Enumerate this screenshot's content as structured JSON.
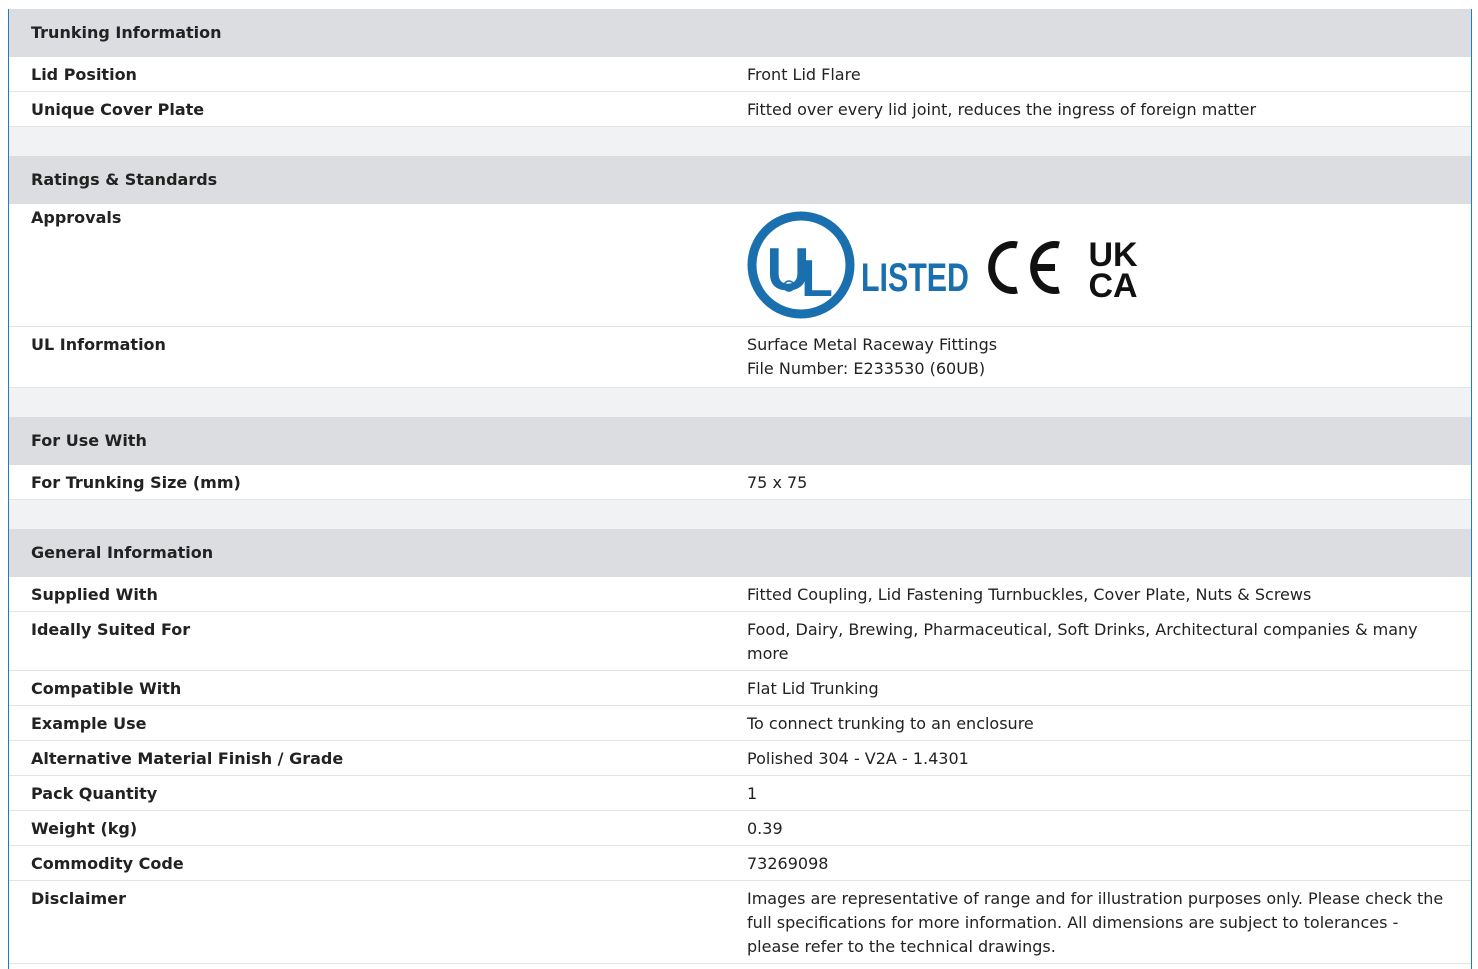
{
  "sections": {
    "trunking": {
      "title": "Trunking Information",
      "rows": [
        {
          "label": "Lid Position",
          "value": "Front Lid Flare"
        },
        {
          "label": "Unique Cover Plate",
          "value": "Fitted over every lid joint, reduces the ingress of foreign matter"
        }
      ]
    },
    "ratings": {
      "title": "Ratings & Standards",
      "approvals_label": "Approvals",
      "logos": {
        "ul_text": "UL",
        "listed_text": "LISTED",
        "ce_text": "CE",
        "ukca_top": "UK",
        "ukca_bottom": "CA"
      },
      "ul_info_label": "UL Information",
      "ul_info_line1": "Surface Metal Raceway Fittings",
      "ul_info_line2": "File Number: E233530 (60UB)"
    },
    "use_with": {
      "title": "For Use With",
      "rows": [
        {
          "label": "For Trunking Size (mm)",
          "value": "75 x 75"
        }
      ]
    },
    "general": {
      "title": "General Information",
      "rows": [
        {
          "label": "Supplied With",
          "value": "Fitted Coupling, Lid Fastening Turnbuckles, Cover Plate, Nuts & Screws"
        },
        {
          "label": "Ideally Suited For",
          "value": "Food, Dairy, Brewing, Pharmaceutical, Soft Drinks, Architectural companies & many more"
        },
        {
          "label": "Compatible With",
          "value": "Flat Lid Trunking"
        },
        {
          "label": "Example Use",
          "value": "To connect trunking to an enclosure"
        },
        {
          "label": "Alternative Material Finish / Grade",
          "value": "Polished 304 - V2A - 1.4301"
        },
        {
          "label": "Pack Quantity",
          "value": "1"
        },
        {
          "label": "Weight (kg)",
          "value": "0.39"
        },
        {
          "label": "Commodity Code",
          "value": "73269098"
        },
        {
          "label": "Disclaimer",
          "value": "Images are representative of range and for illustration purposes only. Please check the full specifications for more information. All dimensions are subject to tolerances - please refer to the technical drawings."
        }
      ]
    }
  },
  "colors": {
    "ul_blue": "#1a6fae",
    "header_bg": "#dcdde0",
    "frame_border": "#1c7fc4"
  }
}
